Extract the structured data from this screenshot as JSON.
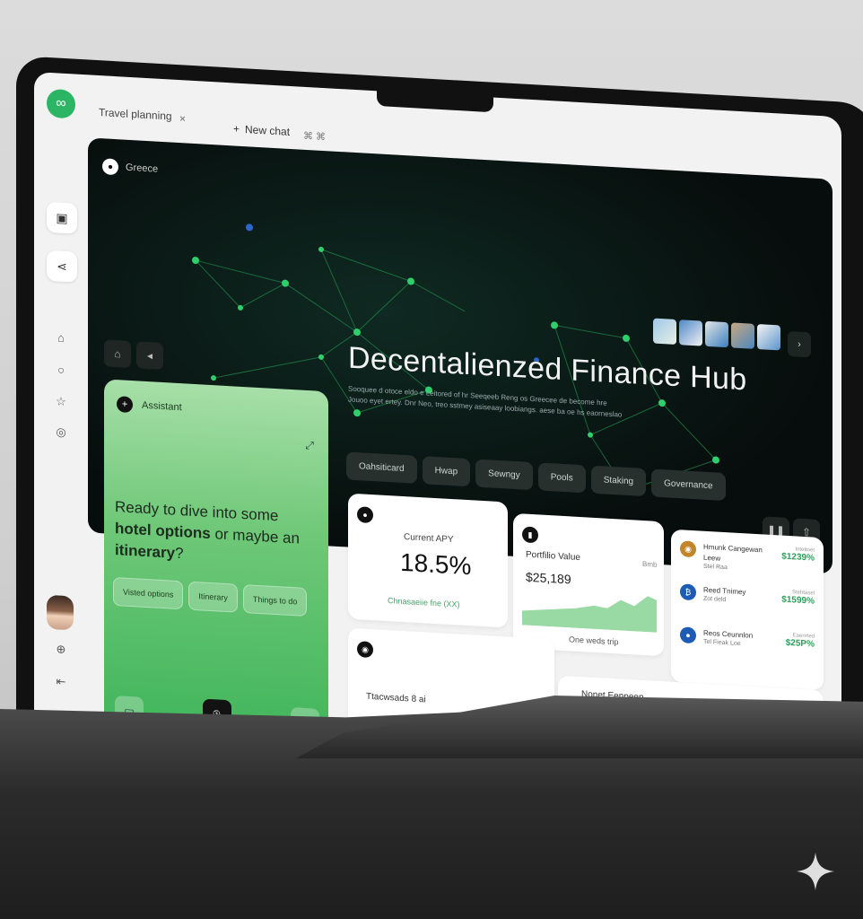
{
  "browser": {
    "tabs": [
      {
        "label": "Travel planning"
      }
    ],
    "new_tab_label": "New chat",
    "tab_close": "×",
    "tab_tools": "⌘ ⌘"
  },
  "sidebar": {
    "icons": [
      "wallet-icon",
      "share-icon",
      "home-icon",
      "chat-icon",
      "star-icon",
      "settings-icon",
      "globe-icon",
      "logout-icon"
    ]
  },
  "hero": {
    "location": "Greece",
    "title": "Decentalienzed Finance Hub",
    "subtitle": "Sooquee d otoce eldo e Leitored of hr Seeqeeb Reng os Greecee de become hre Jouoo eyet ertey. Dnr Neo, treo sstmey asiseaay loobiangs. aese ba oe hs eaorneslao",
    "tabs": [
      {
        "label": "Oahsiticard"
      },
      {
        "label": "Hwap"
      },
      {
        "label": "Sewngy"
      },
      {
        "label": "Pools"
      },
      {
        "label": "Staking"
      },
      {
        "label": "Governance"
      }
    ]
  },
  "assistant": {
    "header": "Assistant",
    "message_part1": "Ready to dive into some ",
    "message_bold1": "hotel options",
    "message_part2": " or maybe an ",
    "message_bold2": "itinerary",
    "message_end": "?",
    "suggestions": [
      {
        "label": "Visted options"
      },
      {
        "label": "Itinerary"
      },
      {
        "label": "Things to do"
      }
    ]
  },
  "stats": {
    "apy_label": "Current APY",
    "apy_value": "18.5%",
    "apy_note": "Chnasaeiie fne (XX)",
    "portfolio_label": "Portfilio Value",
    "portfolio_range": "Bmb",
    "portfolio_value": "$25,189",
    "portfolio_footer": "One weds trip",
    "bottom_left_label": "Ttacwsads 8 ai",
    "bottom_right_label": "Nonet Eenpeen"
  },
  "assets": [
    {
      "name": "Hmunk Cangewan Leew",
      "sub": "Stel Raa",
      "tag": "Intettoet",
      "value": "$1239%",
      "color": "#c2852a"
    },
    {
      "name": "Reed Tnimey",
      "sub": "Zot deld",
      "tag": "Stehtasel",
      "value": "$1599%",
      "color": "#1e5bb5"
    },
    {
      "name": "Reos Ceunnlon",
      "sub": "Tel Fieak Loe",
      "tag": "Eaenrted",
      "value": "$25P%",
      "color": "#1e5bb5"
    }
  ],
  "colors": {
    "accent_green": "#2bb564",
    "hero_bg": "#070d0c",
    "network_node": "#2fd06b"
  }
}
